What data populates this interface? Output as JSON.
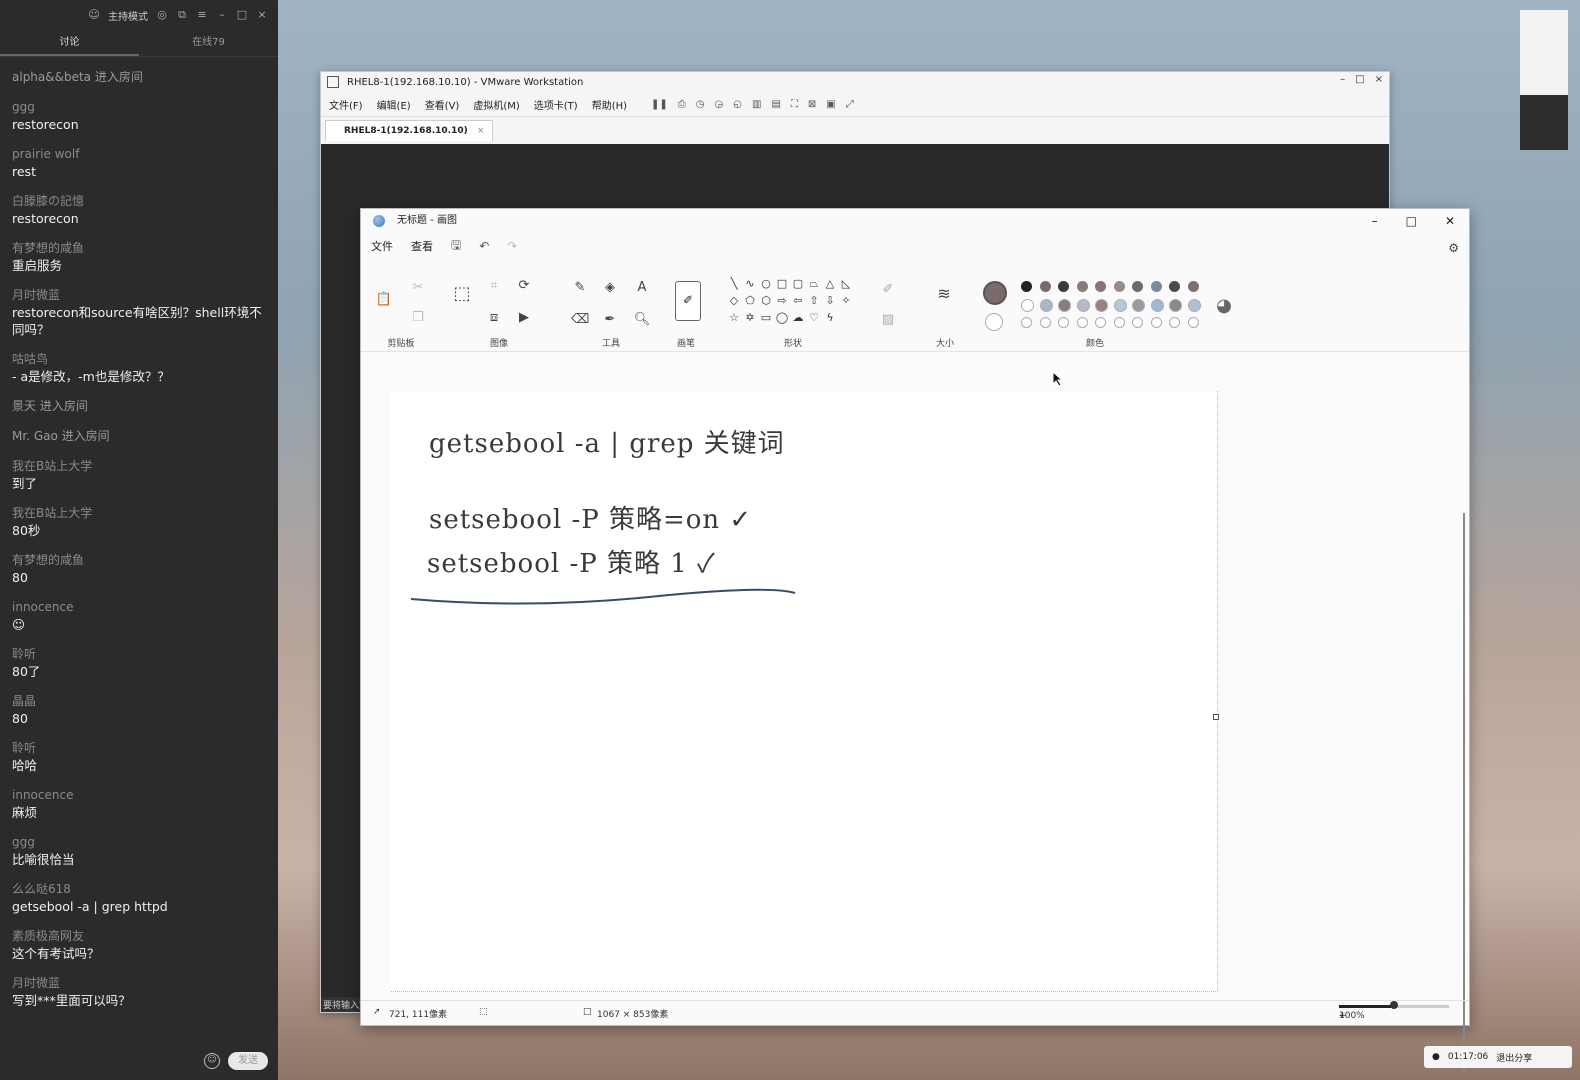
{
  "chat": {
    "topbar_label": "主持模式",
    "tabs": [
      "讨论",
      "在线79"
    ],
    "messages": [
      {
        "name": "alpha&&beta 进入房间",
        "text": ""
      },
      {
        "name": "ggg",
        "text": "restorecon"
      },
      {
        "name": "prairie wolf",
        "text": "rest"
      },
      {
        "name": "白滕膝の記憶",
        "text": "restorecon"
      },
      {
        "name": "有梦想的咸鱼",
        "text": "重启服务"
      },
      {
        "name": "月时微蓝",
        "text": "restorecon和source有啥区别？shell环境不同吗？"
      },
      {
        "name": "咕咕鸟",
        "text": " - a是修改，-m也是修改？？"
      },
      {
        "name": "景天 进入房间",
        "text": ""
      },
      {
        "name": "Mr. Gao 进入房间",
        "text": ""
      },
      {
        "name": "我在B站上大学",
        "text": "到了"
      },
      {
        "name": "我在B站上大学",
        "text": "80秒"
      },
      {
        "name": "有梦想的咸鱼",
        "text": "80"
      },
      {
        "name": "innocence",
        "text": "☺"
      },
      {
        "name": "聆听",
        "text": "80了"
      },
      {
        "name": "晶晶",
        "text": "80"
      },
      {
        "name": "聆听",
        "text": "哈哈"
      },
      {
        "name": "innocence",
        "text": "麻烦"
      },
      {
        "name": "ggg",
        "text": "比喻很恰当"
      },
      {
        "name": "么么哒618",
        "text": "getsebool -a | grep httpd"
      },
      {
        "name": "素质极高网友",
        "text": "这个有考试吗？"
      },
      {
        "name": "月时微蓝",
        "text": "写到***里面可以吗？"
      }
    ],
    "send_label": "发送"
  },
  "vmware": {
    "title": "RHEL8-1(192.168.10.10) - VMware Workstation",
    "menu": [
      "文件(F)",
      "编辑(E)",
      "查看(V)",
      "虚拟机(M)",
      "选项卡(T)",
      "帮助(H)"
    ],
    "tab_label": "RHEL8-1(192.168.10.10)",
    "screen_hint": "要将输入定"
  },
  "paint": {
    "title": "无标题 - 画图",
    "menu": [
      "文件",
      "查看"
    ],
    "groups": {
      "clipboard": "剪贴板",
      "image": "图像",
      "tools": "工具",
      "brushes": "画笔",
      "shapes": "形状",
      "size": "大小",
      "colors": "颜色"
    },
    "canvas_lines": [
      "getsebool -a | grep 关键词",
      "setsebool -P 策略=on ✓",
      "setsebool -P 策略 1  ✓"
    ],
    "status": {
      "cursor_pos": "721, 111像素",
      "canvas_size": "1067 × 853像素",
      "zoom": "100%",
      "zoom_fraction": 0.5
    },
    "palette": [
      "#222222",
      "#7a6a6a",
      "#3a3a3a",
      "#8a7a7a",
      "#8a7080",
      "#9a8a8a",
      "#6a6a6a",
      "#7a8a9a",
      "#4a4a4a",
      "#7a7070"
    ],
    "palette_row2": [
      "#ffffff",
      "#a8b8c8",
      "#8a7a7a",
      "#b8b8c8",
      "#9a8080",
      "#b8c8d8",
      "#9a9aa0",
      "#a0b8d0",
      "#8a8a8a",
      "#b0c0d0"
    ],
    "primary_color": "#7a6a6a"
  },
  "sharebar": {
    "time": "01:17:06",
    "exit_label": "退出分享"
  }
}
